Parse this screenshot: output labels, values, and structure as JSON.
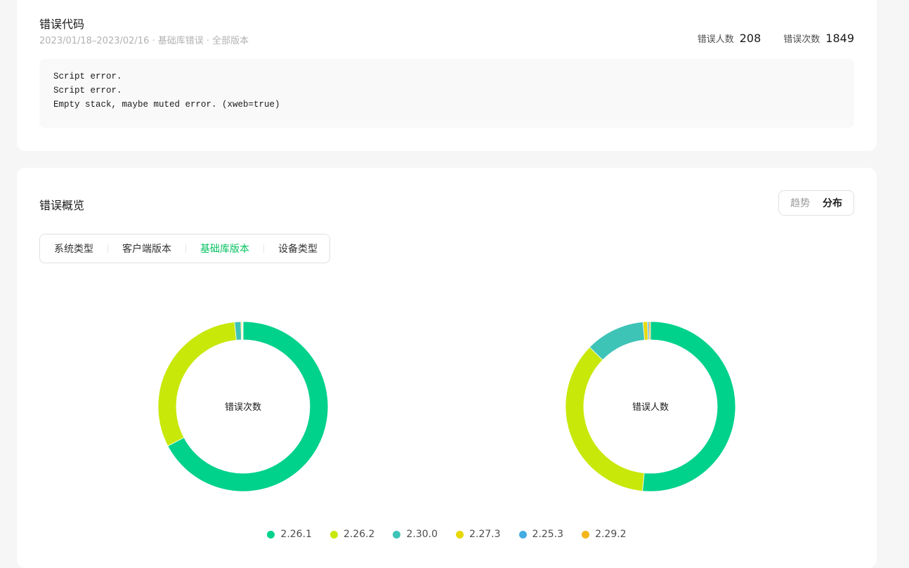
{
  "error_code": {
    "title": "错误代码",
    "subtitle": "2023/01/18–2023/02/16 · 基础库错误 · 全部版本",
    "stats": {
      "users_label": "错误人数",
      "users_value": "208",
      "count_label": "错误次数",
      "count_value": "1849"
    },
    "code_lines": [
      "Script error.",
      "Script error.",
      "Empty stack, maybe muted error. (xweb=true)"
    ]
  },
  "overview": {
    "title": "错误概览",
    "view_toggle": {
      "trend": "趋势",
      "distribution": "分布"
    },
    "tabs": [
      "系统类型",
      "客户端版本",
      "基础库版本",
      "设备类型"
    ],
    "selected_tab": "基础库版本",
    "selected_tab_color": "#07c160"
  },
  "chart_data": [
    {
      "type": "pie",
      "center_label": "错误次数",
      "categories": [
        "2.26.1",
        "2.26.2",
        "2.30.0",
        "2.27.3",
        "2.25.3",
        "2.29.2"
      ],
      "values": [
        0.673,
        0.311,
        0.012,
        0.002,
        0.001,
        0.001
      ]
    },
    {
      "type": "pie",
      "center_label": "错误人数",
      "categories": [
        "2.26.1",
        "2.26.2",
        "2.30.0",
        "2.27.3",
        "2.25.3",
        "2.29.2"
      ],
      "values": [
        0.515,
        0.358,
        0.113,
        0.008,
        0.003,
        0.003
      ]
    }
  ],
  "legend": [
    {
      "label": "2.26.1",
      "color": "#00d18b"
    },
    {
      "label": "2.26.2",
      "color": "#c8e80a"
    },
    {
      "label": "2.30.0",
      "color": "#3ec3b7"
    },
    {
      "label": "2.27.3",
      "color": "#e6d800"
    },
    {
      "label": "2.25.3",
      "color": "#43ace3"
    },
    {
      "label": "2.29.2",
      "color": "#f2b51b"
    }
  ]
}
